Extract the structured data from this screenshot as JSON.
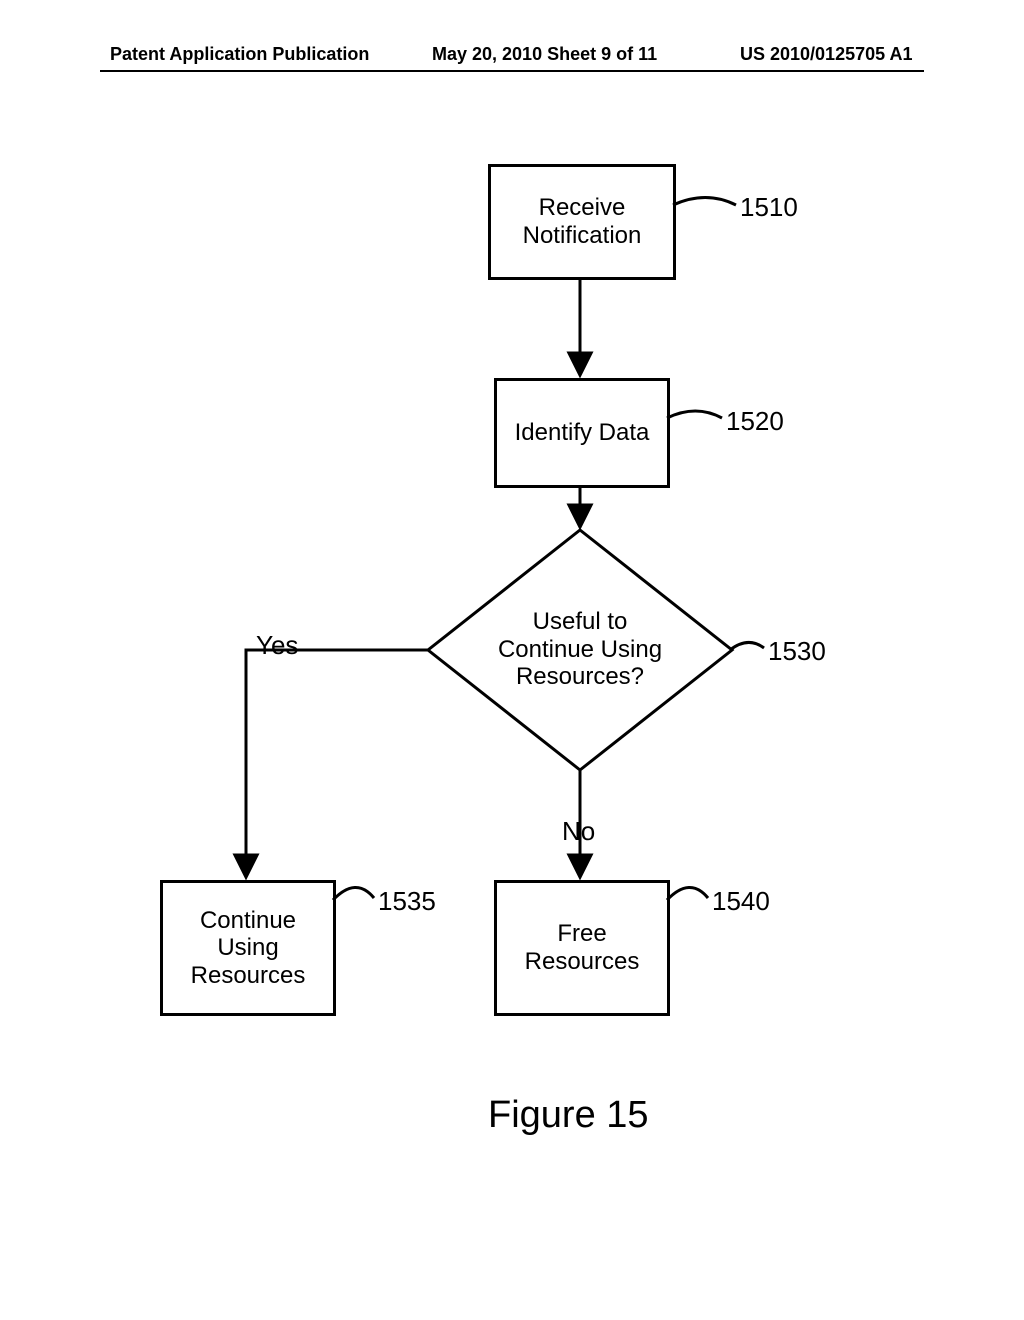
{
  "header": {
    "left": "Patent Application Publication",
    "center": "May 20, 2010  Sheet 9 of 11",
    "right": "US 2010/0125705 A1"
  },
  "flowchart": {
    "nodes": {
      "receive": {
        "label": "Receive\nNotification",
        "ref": "1510"
      },
      "identify": {
        "label": "Identify Data",
        "ref": "1520"
      },
      "decision": {
        "label": "Useful to\nContinue Using\nResources?",
        "ref": "1530"
      },
      "continue": {
        "label": "Continue\nUsing\nResources",
        "ref": "1535"
      },
      "free": {
        "label": "Free\nResources",
        "ref": "1540"
      }
    },
    "edges": {
      "yes": "Yes",
      "no": "No"
    },
    "caption": "Figure 15"
  }
}
